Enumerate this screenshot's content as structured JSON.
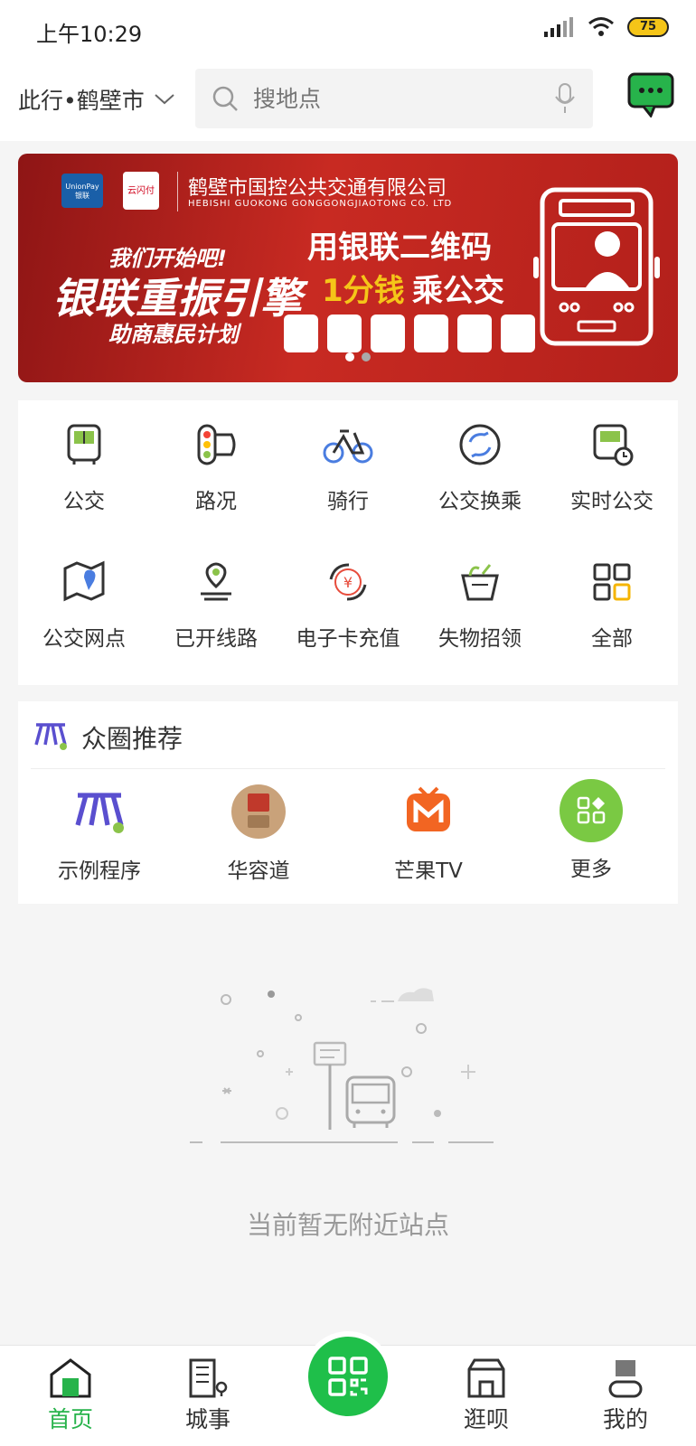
{
  "status_bar": {
    "time": "上午10:29",
    "battery": "75"
  },
  "header": {
    "city": "此行•鹤壁市",
    "search_placeholder": "搜地点"
  },
  "banner": {
    "company_cn": "鹤壁市国控公共交通有限公司",
    "company_en": "HEBISHI GUOKONG GONGGONGJIAOTONG CO. LTD",
    "slogan_top": "我们开始吧!",
    "slogan_main": "银联重振引擎",
    "slogan_sub": "助商惠民计划",
    "headline_1": "用银联二维码",
    "headline_2_a": "1分钱",
    "headline_2_b": "乘公交",
    "unionpay": "UnionPay",
    "unionpay_cn": "银联",
    "quickpass": "云闪付"
  },
  "grid": {
    "items": [
      {
        "label": "公交",
        "icon": "bus-icon"
      },
      {
        "label": "路况",
        "icon": "traffic-light-icon"
      },
      {
        "label": "骑行",
        "icon": "bicycle-icon"
      },
      {
        "label": "公交换乘",
        "icon": "transfer-icon"
      },
      {
        "label": "实时公交",
        "icon": "realtime-bus-icon"
      },
      {
        "label": "公交网点",
        "icon": "map-pin-icon"
      },
      {
        "label": "已开线路",
        "icon": "route-icon"
      },
      {
        "label": "电子卡充值",
        "icon": "recharge-icon"
      },
      {
        "label": "失物招领",
        "icon": "basket-icon"
      },
      {
        "label": "全部",
        "icon": "all-apps-icon"
      }
    ]
  },
  "recommend": {
    "title": "众圈推荐",
    "items": [
      {
        "label": "示例程序",
        "icon": "zhongquan-logo-icon"
      },
      {
        "label": "华容道",
        "icon": "huarongdao-icon"
      },
      {
        "label": "芒果TV",
        "icon": "mango-tv-icon"
      },
      {
        "label": "更多",
        "icon": "more-apps-icon"
      }
    ]
  },
  "empty_state": {
    "text": "当前暂无附近站点"
  },
  "tabbar": {
    "tabs": [
      {
        "label": "首页",
        "active": true
      },
      {
        "label": "城事",
        "active": false
      },
      {
        "label": "逛呗",
        "active": false
      },
      {
        "label": "我的",
        "active": false
      }
    ]
  },
  "colors": {
    "accent": "#27b34b",
    "banner_red": "#c82a22",
    "highlight_yellow": "#f5c518"
  }
}
